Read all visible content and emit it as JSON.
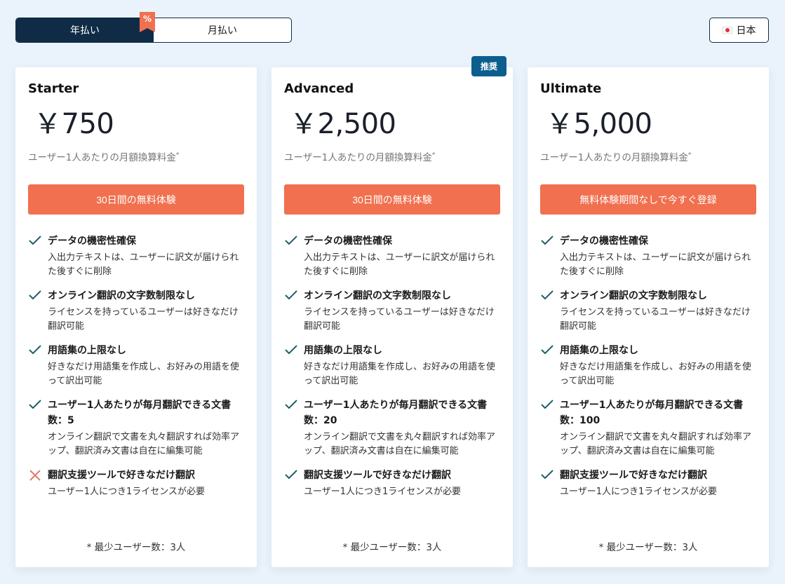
{
  "billing_toggle": {
    "annual_label": "年払い",
    "monthly_label": "月払い",
    "discount_badge": "%",
    "selected": "annual"
  },
  "country_selector": {
    "flag_icon": "japan-flag-icon",
    "label": "日本"
  },
  "colors": {
    "navy": "#0f2b46",
    "cta_orange": "#f0704f",
    "badge_blue": "#0b5e8e",
    "check_teal": "#1f5f6b",
    "cross_red": "#e07a6e",
    "background": "#eaf3fb"
  },
  "plans": [
    {
      "name": "Starter",
      "price": "￥750",
      "price_note": "ユーザー1人あたりの月額換算料金",
      "price_note_mark": "*",
      "cta_label": "30日間の無料体験",
      "badge": null,
      "features": [
        {
          "included": true,
          "title": "データの機密性確保",
          "desc": "入出力テキストは、ユーザーに訳文が届けられた後すぐに削除"
        },
        {
          "included": true,
          "title": "オンライン翻訳の文字数制限なし",
          "desc": "ライセンスを持っているユーザーは好きなだけ翻訳可能"
        },
        {
          "included": true,
          "title": "用語集の上限なし",
          "desc": "好きなだけ用語集を作成し、お好みの用語を使って訳出可能"
        },
        {
          "included": true,
          "title": "ユーザー1人あたりが毎月翻訳できる文書数：5",
          "desc": "オンライン翻訳で文書を丸々翻訳すれば効率アップ、翻訳済み文書は自在に編集可能"
        },
        {
          "included": false,
          "title": "翻訳支援ツールで好きなだけ翻訳",
          "desc": "ユーザー1人につき1ライセンスが必要"
        }
      ],
      "footnote": "* 最少ユーザー数：3人"
    },
    {
      "name": "Advanced",
      "price": "￥2,500",
      "price_note": "ユーザー1人あたりの月額換算料金",
      "price_note_mark": "*",
      "cta_label": "30日間の無料体験",
      "badge": "推奨",
      "features": [
        {
          "included": true,
          "title": "データの機密性確保",
          "desc": "入出力テキストは、ユーザーに訳文が届けられた後すぐに削除"
        },
        {
          "included": true,
          "title": "オンライン翻訳の文字数制限なし",
          "desc": "ライセンスを持っているユーザーは好きなだけ翻訳可能"
        },
        {
          "included": true,
          "title": "用語集の上限なし",
          "desc": "好きなだけ用語集を作成し、お好みの用語を使って訳出可能"
        },
        {
          "included": true,
          "title": "ユーザー1人あたりが毎月翻訳できる文書数：20",
          "desc": "オンライン翻訳で文書を丸々翻訳すれば効率アップ、翻訳済み文書は自在に編集可能"
        },
        {
          "included": true,
          "title": "翻訳支援ツールで好きなだけ翻訳",
          "desc": "ユーザー1人につき1ライセンスが必要"
        }
      ],
      "footnote": "* 最少ユーザー数：3人"
    },
    {
      "name": "Ultimate",
      "price": "￥5,000",
      "price_note": "ユーザー1人あたりの月額換算料金",
      "price_note_mark": "*",
      "cta_label": "無料体験期間なしで今すぐ登録",
      "badge": null,
      "features": [
        {
          "included": true,
          "title": "データの機密性確保",
          "desc": "入出力テキストは、ユーザーに訳文が届けられた後すぐに削除"
        },
        {
          "included": true,
          "title": "オンライン翻訳の文字数制限なし",
          "desc": "ライセンスを持っているユーザーは好きなだけ翻訳可能"
        },
        {
          "included": true,
          "title": "用語集の上限なし",
          "desc": "好きなだけ用語集を作成し、お好みの用語を使って訳出可能"
        },
        {
          "included": true,
          "title": "ユーザー1人あたりが毎月翻訳できる文書数：100",
          "desc": "オンライン翻訳で文書を丸々翻訳すれば効率アップ、翻訳済み文書は自在に編集可能"
        },
        {
          "included": true,
          "title": "翻訳支援ツールで好きなだけ翻訳",
          "desc": "ユーザー1人につき1ライセンスが必要"
        }
      ],
      "footnote": "* 最少ユーザー数：3人"
    }
  ]
}
